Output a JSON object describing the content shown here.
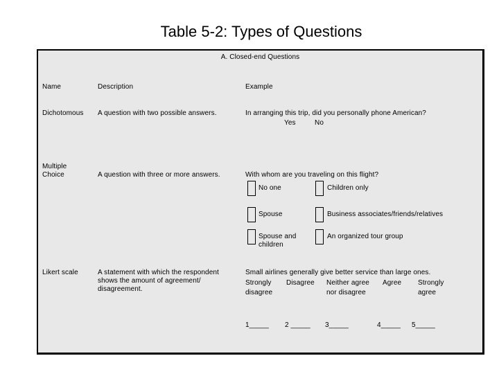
{
  "title": "Table 5-2: Types of Questions",
  "section_title": "A. Closed-end Questions",
  "headers": {
    "name": "Name",
    "description": "Description",
    "example": "Example"
  },
  "rows": {
    "dichotomous": {
      "name": "Dichotomous",
      "description": "A question with two possible answers.",
      "question": "In arranging this trip, did you personally phone American?",
      "options": [
        "Yes",
        "No"
      ]
    },
    "multiple_choice": {
      "name_line1": "Multiple",
      "name_line2": "Choice",
      "description": "A question with three or more answers.",
      "question": "With whom are you traveling on this flight?",
      "options": [
        {
          "label": "No one",
          "checked": false
        },
        {
          "label": "Children only",
          "checked": false
        },
        {
          "label": "Spouse",
          "checked": false
        },
        {
          "label": "Business associates/friends/relatives",
          "checked": false
        },
        {
          "label_line1": "Spouse and",
          "label_line2": "children",
          "checked": false
        },
        {
          "label": "An organized tour group",
          "checked": false
        }
      ]
    },
    "likert": {
      "name": "Likert scale",
      "description_lines": [
        "A statement with which the respondent",
        "shows the amount of agreement/",
        "disagreement."
      ],
      "statement": "Small airlines generally give better service than large ones.",
      "scale": [
        {
          "line1": "Strongly",
          "line2": "disagree",
          "blank": "1_____"
        },
        {
          "line1": "Disagree",
          "line2": "",
          "blank": "2 _____"
        },
        {
          "line1": "Neither agree",
          "line2": "nor disagree",
          "blank": "3_____"
        },
        {
          "line1": "Agree",
          "line2": "",
          "blank": "4_____"
        },
        {
          "line1": "Strongly",
          "line2": "agree",
          "blank": "5_____"
        }
      ]
    }
  },
  "colors": {
    "box_fill": "#e8e8e8",
    "border": "#000000",
    "text": "#000000"
  }
}
